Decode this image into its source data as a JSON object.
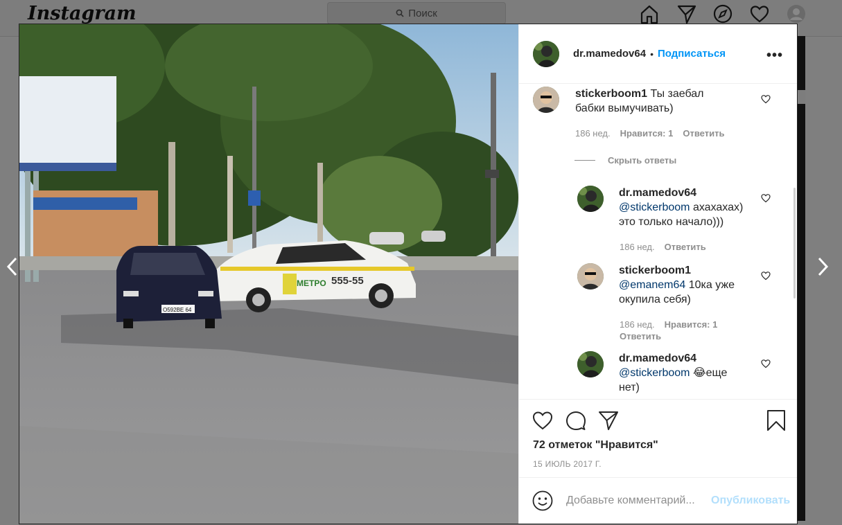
{
  "background": {
    "logo": "Instagram",
    "search_placeholder": "Поиск"
  },
  "post": {
    "username": "dr.mamedov64",
    "dot": "•",
    "follow_label": "Подписаться",
    "more_label": "•••",
    "photo_plate_text": "METPO",
    "photo_phone_text": "555-55",
    "photo_license_text": "O592BE 64"
  },
  "comments": [
    {
      "user": "stickerboom1",
      "text": "Ты заебал бабки вымучивать)",
      "time": "186 нед.",
      "likes": "Нравится: 1",
      "reply": "Ответить"
    }
  ],
  "hide_replies": "Скрыть ответы",
  "replies": [
    {
      "user": "dr.mamedov64",
      "mention": "@stickerboom",
      "text": " ахахахах) это только начало)))",
      "time": "186 нед.",
      "reply": "Ответить"
    },
    {
      "user": "stickerboom1",
      "mention": "@emanem64",
      "text": " 10ка уже окупила себя)",
      "time": "186 нед.",
      "likes": "Нравится: 1",
      "reply": "Ответить"
    },
    {
      "user": "dr.mamedov64",
      "mention": "@stickerboom",
      "emoji": "😂",
      "text": "еще нет)"
    }
  ],
  "likes_count": "72 отметок \"Нравится\"",
  "date": "15 ИЮЛЬ 2017 Г.",
  "comment_placeholder": "Добавьте комментарий...",
  "publish_label": "Опубликовать",
  "colors": {
    "accent": "#0095f6",
    "publish_disabled": "#b2dffc",
    "mention": "#00376b",
    "meta": "#8e8e8e"
  }
}
